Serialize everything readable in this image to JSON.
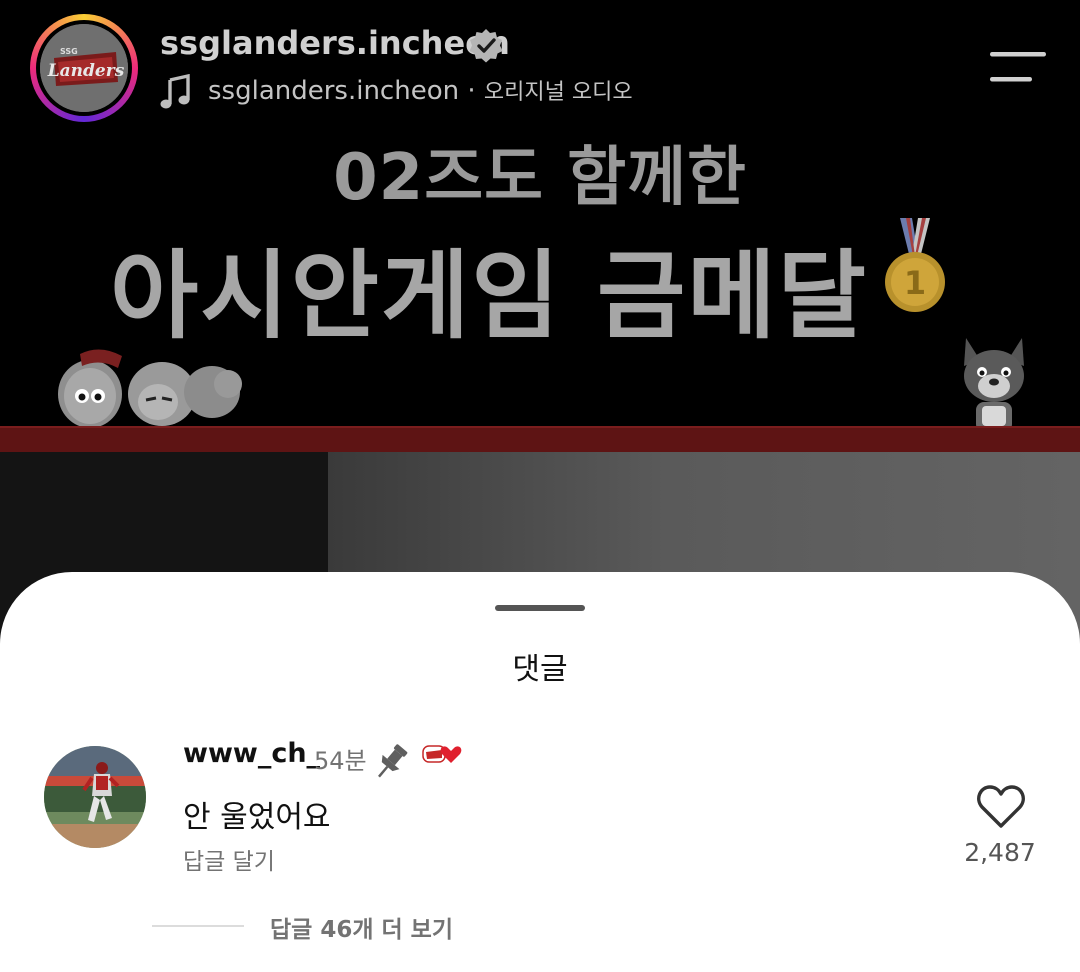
{
  "post": {
    "account_name": "ssglanders.incheon",
    "audio_account": "ssglanders.incheon",
    "audio_separator": "·",
    "audio_label": "오리지널 오디오",
    "avatar_logo_text": "Landers",
    "avatar_logo_small": "SSG"
  },
  "video": {
    "headline_line1": "02즈도 함께한",
    "headline_line2": "아시안게임 금메달",
    "medal_number": "1"
  },
  "comments": {
    "title": "댓글",
    "items": [
      {
        "username": "www_ch_",
        "time": "54분",
        "text": "안 울었어요",
        "reply_label": "답글 달기",
        "like_count": "2,487",
        "view_replies_label": "답글 46개 더 보기",
        "pinned": true,
        "liked_by_creator": true
      }
    ]
  },
  "colors": {
    "sheet_bg": "#ffffff",
    "secondary_text": "#737373",
    "accent_red": "#e0202e",
    "story_ring": [
      "#f9ce34",
      "#ee2a7b",
      "#6228d7"
    ]
  },
  "icons": [
    "verified-icon",
    "music-note-icon",
    "menu-icon",
    "pin-icon",
    "creator-heart-icon",
    "heart-icon"
  ]
}
